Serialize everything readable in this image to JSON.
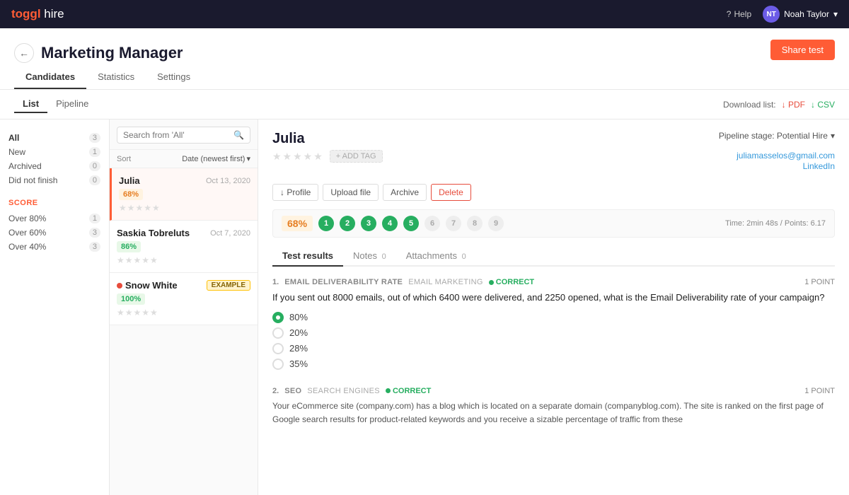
{
  "topNav": {
    "logo": "toggl",
    "logoSuffix": " hire",
    "helpLabel": "Help",
    "userName": "Noah Taylor",
    "userInitials": "NT"
  },
  "pageHeader": {
    "title": "Marketing Manager",
    "backLabel": "←",
    "tabs": [
      {
        "id": "candidates",
        "label": "Candidates",
        "active": true
      },
      {
        "id": "statistics",
        "label": "Statistics",
        "active": false
      },
      {
        "id": "settings",
        "label": "Settings",
        "active": false
      }
    ],
    "shareLabel": "Share test"
  },
  "viewTabs": [
    {
      "id": "list",
      "label": "List",
      "active": true
    },
    {
      "id": "pipeline",
      "label": "Pipeline",
      "active": false
    }
  ],
  "download": {
    "label": "Download list:",
    "pdfLabel": "↓ PDF",
    "csvLabel": "↓ CSV"
  },
  "filters": {
    "statusItems": [
      {
        "label": "All",
        "count": "3",
        "active": true
      },
      {
        "label": "New",
        "count": "1",
        "active": false
      },
      {
        "label": "Archived",
        "count": "0",
        "active": false
      },
      {
        "label": "Did not finish",
        "count": "0",
        "active": false
      }
    ],
    "scoreTitle": "SCORE",
    "scoreItems": [
      {
        "label": "Over 80%",
        "count": "1"
      },
      {
        "label": "Over 60%",
        "count": "3"
      },
      {
        "label": "Over 40%",
        "count": "3"
      }
    ]
  },
  "search": {
    "placeholder": "Search from 'All'"
  },
  "sort": {
    "label": "Sort",
    "value": "Date (newest first)"
  },
  "candidates": [
    {
      "id": "julia",
      "name": "Julia",
      "date": "Oct 13, 2020",
      "score": "68%",
      "scoreClass": "score-orange",
      "stars": "★★★★★",
      "active": true,
      "tag": null,
      "dot": false
    },
    {
      "id": "saskia",
      "name": "Saskia Tobreluts",
      "date": "Oct 7, 2020",
      "score": "86%",
      "scoreClass": "score-green",
      "stars": "★★★★★",
      "active": false,
      "tag": null,
      "dot": false
    },
    {
      "id": "snow",
      "name": "Snow White",
      "date": "",
      "score": "100%",
      "scoreClass": "score-green",
      "stars": "★★★★★",
      "active": false,
      "tag": "EXAMPLE",
      "dot": true
    }
  ],
  "candidateDetail": {
    "name": "Julia",
    "pipelineStage": "Pipeline stage: Potential Hire",
    "email": "juliamasselos@gmail.com",
    "linkedin": "LinkedIn",
    "stars": "★★★★★",
    "addTagLabel": "+ ADD TAG",
    "actions": [
      {
        "id": "profile",
        "label": "↓ Profile"
      },
      {
        "id": "upload",
        "label": "Upload file"
      },
      {
        "id": "archive",
        "label": "Archive"
      },
      {
        "id": "delete",
        "label": "Delete"
      }
    ],
    "score": "68%",
    "scoreNums": [
      "1",
      "2",
      "3",
      "4",
      "5",
      "6",
      "7",
      "8",
      "9"
    ],
    "scoreActiveCount": 5,
    "timeInfo": "Time: 2min 48s / Points: 6.17",
    "tabs": [
      {
        "id": "test-results",
        "label": "Test results",
        "count": "",
        "active": true
      },
      {
        "id": "notes",
        "label": "Notes",
        "count": "0",
        "active": false
      },
      {
        "id": "attachments",
        "label": "Attachments",
        "count": "0",
        "active": false
      }
    ],
    "questions": [
      {
        "number": "1.",
        "category": "EMAIL DELIVERABILITY RATE",
        "tag": "EMAIL MARKETING",
        "correct": true,
        "correctLabel": "CORRECT",
        "points": "1 POINT",
        "text": "If you sent out 8000 emails, out of which 6400 were delivered, and 2250 opened, what is the Email Deliverability rate of your campaign?",
        "options": [
          {
            "label": "80%",
            "selected": true
          },
          {
            "label": "20%",
            "selected": false
          },
          {
            "label": "28%",
            "selected": false
          },
          {
            "label": "35%",
            "selected": false
          }
        ]
      },
      {
        "number": "2.",
        "category": "SEO",
        "tag": "SEARCH ENGINES",
        "correct": true,
        "correctLabel": "CORRECT",
        "points": "1 POINT",
        "text": "Your eCommerce site (company.com) has a blog which is located on a separate domain (companyblog.com). The site is ranked on the first page of Google search results for product-related keywords and you receive a sizable percentage of traffic from these",
        "options": []
      }
    ]
  }
}
